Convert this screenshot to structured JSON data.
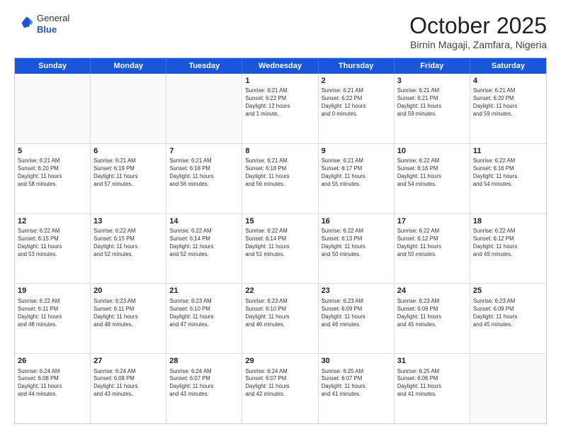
{
  "logo": {
    "general": "General",
    "blue": "Blue"
  },
  "header": {
    "month": "October 2025",
    "location": "Birnin Magaji, Zamfara, Nigeria"
  },
  "weekdays": [
    "Sunday",
    "Monday",
    "Tuesday",
    "Wednesday",
    "Thursday",
    "Friday",
    "Saturday"
  ],
  "rows": [
    [
      {
        "day": "",
        "empty": true
      },
      {
        "day": "",
        "empty": true
      },
      {
        "day": "",
        "empty": true
      },
      {
        "day": "1",
        "line1": "Sunrise: 6:21 AM",
        "line2": "Sunset: 6:22 PM",
        "line3": "Daylight: 12 hours",
        "line4": "and 1 minute."
      },
      {
        "day": "2",
        "line1": "Sunrise: 6:21 AM",
        "line2": "Sunset: 6:22 PM",
        "line3": "Daylight: 12 hours",
        "line4": "and 0 minutes."
      },
      {
        "day": "3",
        "line1": "Sunrise: 6:21 AM",
        "line2": "Sunset: 6:21 PM",
        "line3": "Daylight: 11 hours",
        "line4": "and 59 minutes."
      },
      {
        "day": "4",
        "line1": "Sunrise: 6:21 AM",
        "line2": "Sunset: 6:20 PM",
        "line3": "Daylight: 11 hours",
        "line4": "and 59 minutes."
      }
    ],
    [
      {
        "day": "5",
        "line1": "Sunrise: 6:21 AM",
        "line2": "Sunset: 6:20 PM",
        "line3": "Daylight: 11 hours",
        "line4": "and 58 minutes."
      },
      {
        "day": "6",
        "line1": "Sunrise: 6:21 AM",
        "line2": "Sunset: 6:19 PM",
        "line3": "Daylight: 11 hours",
        "line4": "and 57 minutes."
      },
      {
        "day": "7",
        "line1": "Sunrise: 6:21 AM",
        "line2": "Sunset: 6:18 PM",
        "line3": "Daylight: 11 hours",
        "line4": "and 56 minutes."
      },
      {
        "day": "8",
        "line1": "Sunrise: 6:21 AM",
        "line2": "Sunset: 6:18 PM",
        "line3": "Daylight: 11 hours",
        "line4": "and 56 minutes."
      },
      {
        "day": "9",
        "line1": "Sunrise: 6:21 AM",
        "line2": "Sunset: 6:17 PM",
        "line3": "Daylight: 11 hours",
        "line4": "and 55 minutes."
      },
      {
        "day": "10",
        "line1": "Sunrise: 6:22 AM",
        "line2": "Sunset: 6:16 PM",
        "line3": "Daylight: 11 hours",
        "line4": "and 54 minutes."
      },
      {
        "day": "11",
        "line1": "Sunrise: 6:22 AM",
        "line2": "Sunset: 6:16 PM",
        "line3": "Daylight: 11 hours",
        "line4": "and 54 minutes."
      }
    ],
    [
      {
        "day": "12",
        "line1": "Sunrise: 6:22 AM",
        "line2": "Sunset: 6:15 PM",
        "line3": "Daylight: 11 hours",
        "line4": "and 53 minutes."
      },
      {
        "day": "13",
        "line1": "Sunrise: 6:22 AM",
        "line2": "Sunset: 6:15 PM",
        "line3": "Daylight: 11 hours",
        "line4": "and 52 minutes."
      },
      {
        "day": "14",
        "line1": "Sunrise: 6:22 AM",
        "line2": "Sunset: 6:14 PM",
        "line3": "Daylight: 11 hours",
        "line4": "and 52 minutes."
      },
      {
        "day": "15",
        "line1": "Sunrise: 6:22 AM",
        "line2": "Sunset: 6:14 PM",
        "line3": "Daylight: 11 hours",
        "line4": "and 51 minutes."
      },
      {
        "day": "16",
        "line1": "Sunrise: 6:22 AM",
        "line2": "Sunset: 6:13 PM",
        "line3": "Daylight: 11 hours",
        "line4": "and 50 minutes."
      },
      {
        "day": "17",
        "line1": "Sunrise: 6:22 AM",
        "line2": "Sunset: 6:12 PM",
        "line3": "Daylight: 11 hours",
        "line4": "and 50 minutes."
      },
      {
        "day": "18",
        "line1": "Sunrise: 6:22 AM",
        "line2": "Sunset: 6:12 PM",
        "line3": "Daylight: 11 hours",
        "line4": "and 49 minutes."
      }
    ],
    [
      {
        "day": "19",
        "line1": "Sunrise: 6:22 AM",
        "line2": "Sunset: 6:11 PM",
        "line3": "Daylight: 11 hours",
        "line4": "and 48 minutes."
      },
      {
        "day": "20",
        "line1": "Sunrise: 6:23 AM",
        "line2": "Sunset: 6:11 PM",
        "line3": "Daylight: 11 hours",
        "line4": "and 48 minutes."
      },
      {
        "day": "21",
        "line1": "Sunrise: 6:23 AM",
        "line2": "Sunset: 6:10 PM",
        "line3": "Daylight: 11 hours",
        "line4": "and 47 minutes."
      },
      {
        "day": "22",
        "line1": "Sunrise: 6:23 AM",
        "line2": "Sunset: 6:10 PM",
        "line3": "Daylight: 11 hours",
        "line4": "and 46 minutes."
      },
      {
        "day": "23",
        "line1": "Sunrise: 6:23 AM",
        "line2": "Sunset: 6:09 PM",
        "line3": "Daylight: 11 hours",
        "line4": "and 46 minutes."
      },
      {
        "day": "24",
        "line1": "Sunrise: 6:23 AM",
        "line2": "Sunset: 6:09 PM",
        "line3": "Daylight: 11 hours",
        "line4": "and 45 minutes."
      },
      {
        "day": "25",
        "line1": "Sunrise: 6:23 AM",
        "line2": "Sunset: 6:09 PM",
        "line3": "Daylight: 11 hours",
        "line4": "and 45 minutes."
      }
    ],
    [
      {
        "day": "26",
        "line1": "Sunrise: 6:24 AM",
        "line2": "Sunset: 6:08 PM",
        "line3": "Daylight: 11 hours",
        "line4": "and 44 minutes."
      },
      {
        "day": "27",
        "line1": "Sunrise: 6:24 AM",
        "line2": "Sunset: 6:08 PM",
        "line3": "Daylight: 11 hours",
        "line4": "and 43 minutes."
      },
      {
        "day": "28",
        "line1": "Sunrise: 6:24 AM",
        "line2": "Sunset: 6:07 PM",
        "line3": "Daylight: 11 hours",
        "line4": "and 43 minutes."
      },
      {
        "day": "29",
        "line1": "Sunrise: 6:24 AM",
        "line2": "Sunset: 6:07 PM",
        "line3": "Daylight: 11 hours",
        "line4": "and 42 minutes."
      },
      {
        "day": "30",
        "line1": "Sunrise: 6:25 AM",
        "line2": "Sunset: 6:07 PM",
        "line3": "Daylight: 11 hours",
        "line4": "and 41 minutes."
      },
      {
        "day": "31",
        "line1": "Sunrise: 6:25 AM",
        "line2": "Sunset: 6:06 PM",
        "line3": "Daylight: 11 hours",
        "line4": "and 41 minutes."
      },
      {
        "day": "",
        "empty": true
      }
    ]
  ]
}
